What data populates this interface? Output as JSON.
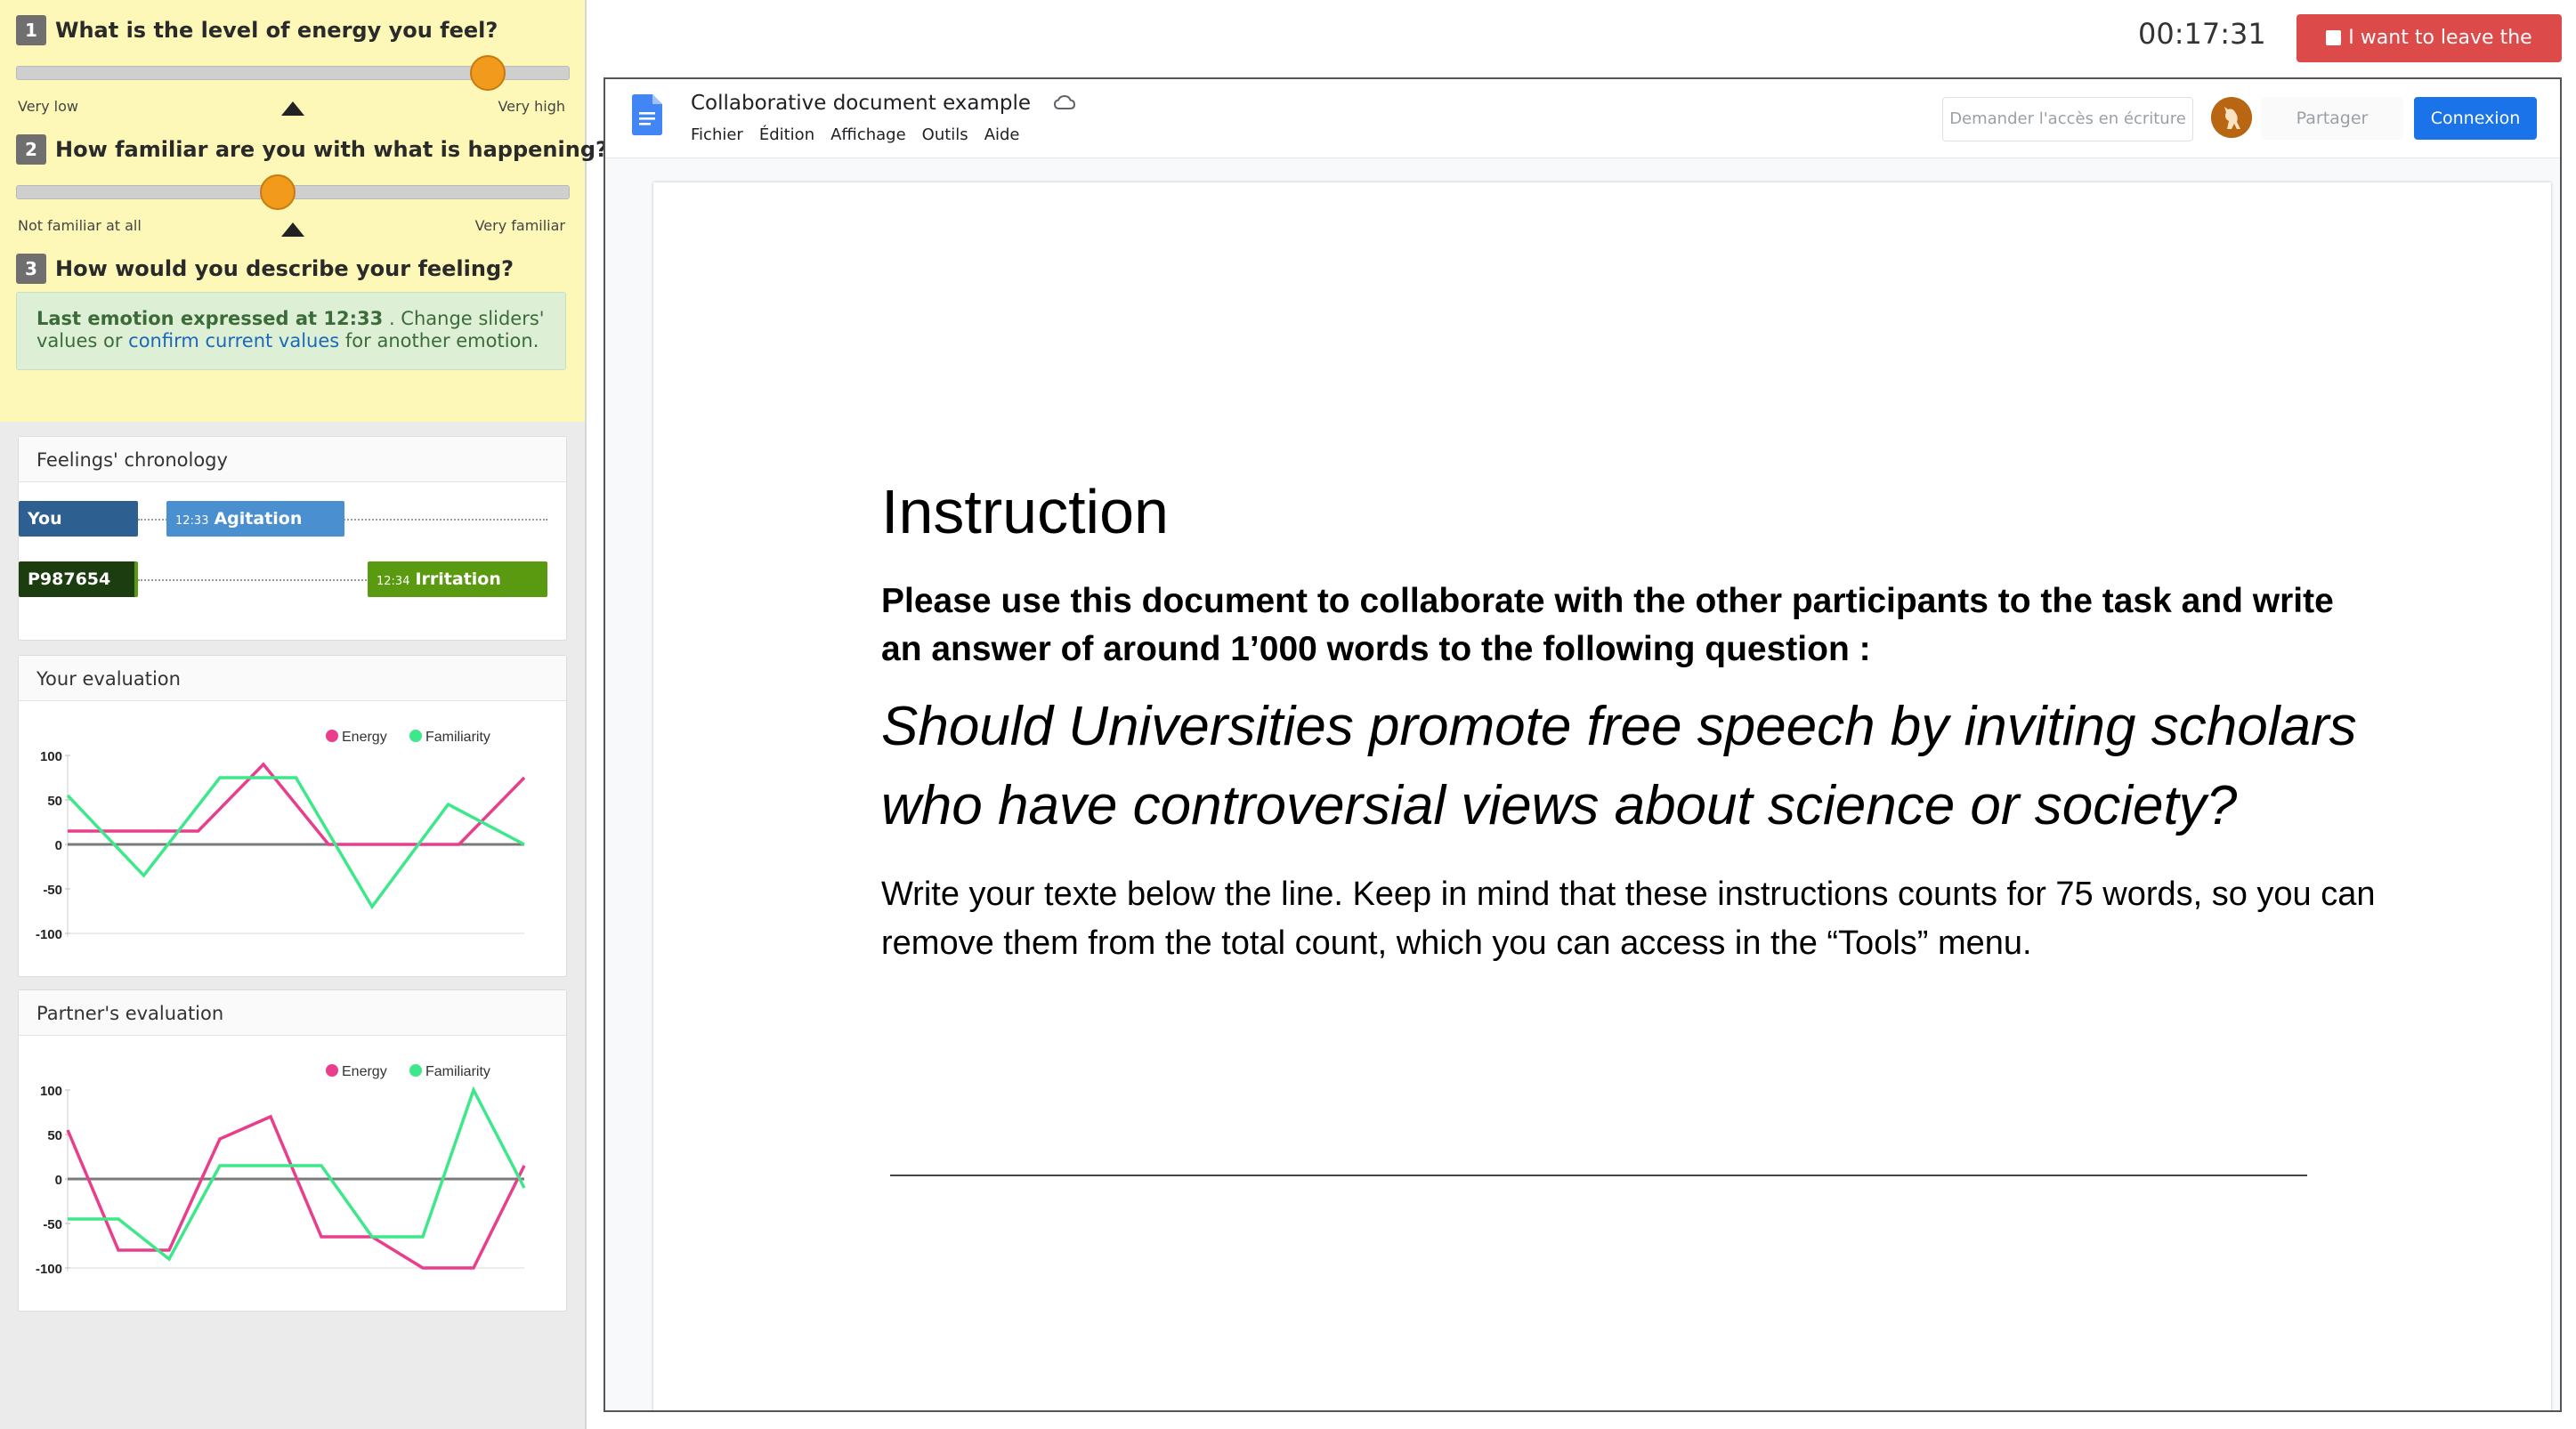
{
  "questions": [
    {
      "num": "1",
      "text": "What is the level of energy you feel?",
      "min_label": "Very low",
      "max_label": "Very high",
      "value": 0.85
    },
    {
      "num": "2",
      "text": "How familiar are you with what is happening?",
      "min_label": "Not familiar at all",
      "max_label": "Very familiar",
      "value": 0.47
    },
    {
      "num": "3",
      "text": "How would you describe your feeling?"
    }
  ],
  "emotion_box": {
    "prefix": "Last emotion expressed at 12:33",
    "middle": ". Change sliders' values or",
    "link": "confirm current values",
    "suffix": "for another emotion."
  },
  "chronology": {
    "title": "Feelings' chronology",
    "rows": [
      {
        "participant": "You",
        "time": "12:33",
        "emotion": "Agitation",
        "color": "#4a8fd0",
        "tag_color": "#2e5f91"
      },
      {
        "participant": "P987654",
        "time": "12:34",
        "emotion": "Irritation",
        "color": "#5a9a10",
        "tag_color": "#1c3d10"
      }
    ]
  },
  "your_eval": {
    "title": "Your evaluation",
    "legend": [
      "Energy",
      "Familiarity"
    ]
  },
  "partner_eval": {
    "title": "Partner's evaluation",
    "legend": [
      "Energy",
      "Familiarity"
    ]
  },
  "chart_data": [
    {
      "type": "line",
      "title": "Your evaluation",
      "ylim": [
        -100,
        100
      ],
      "yticks": [
        100,
        50,
        0,
        -50,
        -100
      ],
      "x": [
        0,
        1,
        2,
        3,
        4,
        5,
        6,
        7,
        8
      ],
      "series": [
        {
          "name": "Energy",
          "color": "#e83e8c",
          "values": [
            15,
            15,
            15,
            90,
            0,
            0,
            0,
            75
          ]
        },
        {
          "name": "Familiarity",
          "color": "#3de88a",
          "values": [
            55,
            -35,
            75,
            75,
            -70,
            45,
            0
          ]
        }
      ]
    },
    {
      "type": "line",
      "title": "Partner's evaluation",
      "ylim": [
        -100,
        100
      ],
      "yticks": [
        100,
        50,
        0,
        -50,
        -100
      ],
      "series": [
        {
          "name": "Energy",
          "color": "#e83e8c",
          "values": [
            55,
            -80,
            -80,
            45,
            70,
            -65,
            -65,
            -100,
            -100,
            15
          ]
        },
        {
          "name": "Familiarity",
          "color": "#3de88a",
          "values": [
            -45,
            -45,
            -90,
            15,
            15,
            15,
            -65,
            -65,
            100,
            -10
          ]
        }
      ]
    }
  ],
  "timer": "00:17:31",
  "leave_button": "I want to leave the study",
  "doc": {
    "title": "Collaborative document example",
    "menu": [
      "Fichier",
      "Édition",
      "Affichage",
      "Outils",
      "Aide"
    ],
    "request_access": "Demander l'accès en écriture",
    "share": "Partager",
    "login": "Connexion",
    "heading": "Instruction",
    "bold_text": "Please use this document to collaborate with the other participants to the task and write an answer of around 1’000 words to the following question :",
    "question": "Should Universities promote free speech by inviting scholars who have controversial views about science or society?",
    "body": "Write your texte below the line. Keep in mind that these instructions counts for 75 words, so you can remove them from the total count, which you can access in the “Tools” menu."
  }
}
